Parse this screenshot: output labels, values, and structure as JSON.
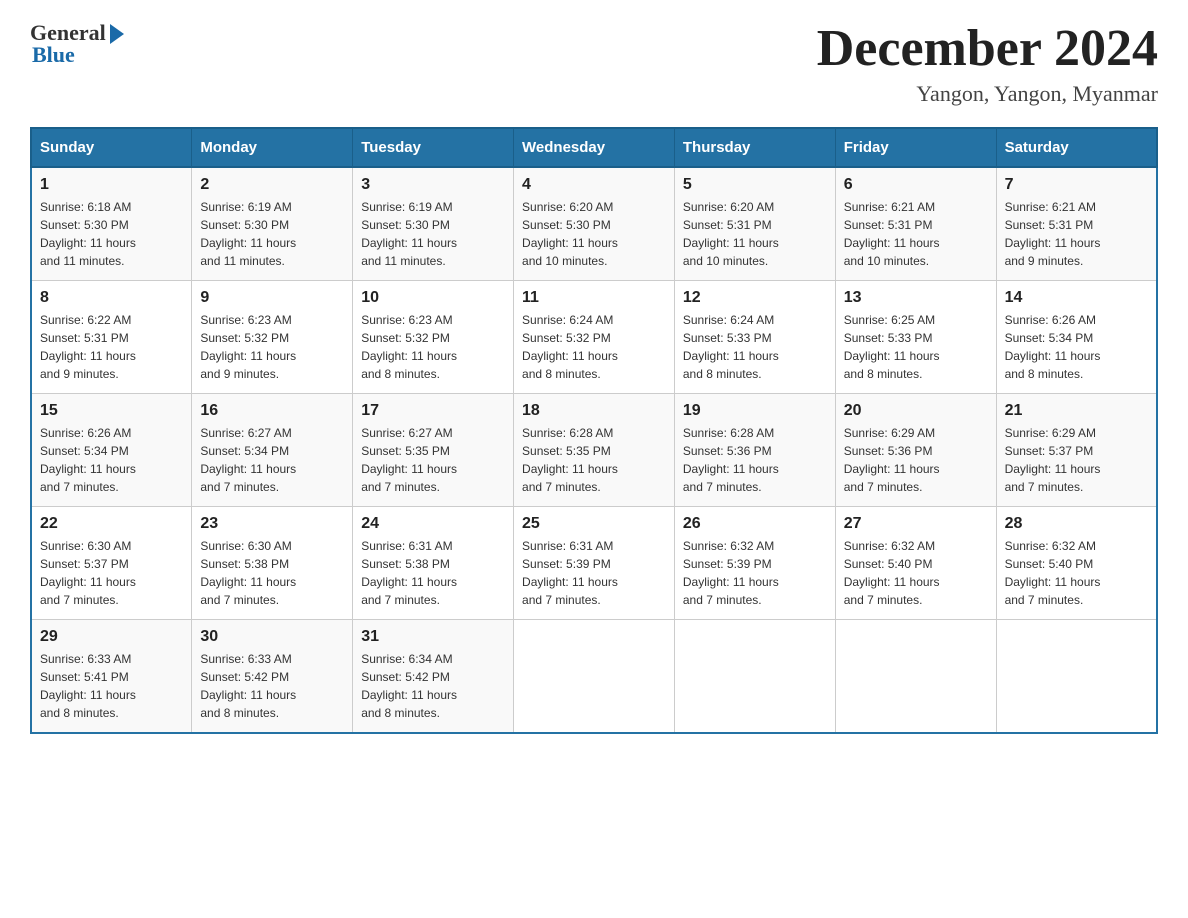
{
  "header": {
    "logo_general": "General",
    "logo_blue": "Blue",
    "month_title": "December 2024",
    "location": "Yangon, Yangon, Myanmar"
  },
  "days_of_week": [
    "Sunday",
    "Monday",
    "Tuesday",
    "Wednesday",
    "Thursday",
    "Friday",
    "Saturday"
  ],
  "weeks": [
    [
      {
        "num": "1",
        "sunrise": "6:18 AM",
        "sunset": "5:30 PM",
        "daylight": "11 hours and 11 minutes."
      },
      {
        "num": "2",
        "sunrise": "6:19 AM",
        "sunset": "5:30 PM",
        "daylight": "11 hours and 11 minutes."
      },
      {
        "num": "3",
        "sunrise": "6:19 AM",
        "sunset": "5:30 PM",
        "daylight": "11 hours and 11 minutes."
      },
      {
        "num": "4",
        "sunrise": "6:20 AM",
        "sunset": "5:30 PM",
        "daylight": "11 hours and 10 minutes."
      },
      {
        "num": "5",
        "sunrise": "6:20 AM",
        "sunset": "5:31 PM",
        "daylight": "11 hours and 10 minutes."
      },
      {
        "num": "6",
        "sunrise": "6:21 AM",
        "sunset": "5:31 PM",
        "daylight": "11 hours and 10 minutes."
      },
      {
        "num": "7",
        "sunrise": "6:21 AM",
        "sunset": "5:31 PM",
        "daylight": "11 hours and 9 minutes."
      }
    ],
    [
      {
        "num": "8",
        "sunrise": "6:22 AM",
        "sunset": "5:31 PM",
        "daylight": "11 hours and 9 minutes."
      },
      {
        "num": "9",
        "sunrise": "6:23 AM",
        "sunset": "5:32 PM",
        "daylight": "11 hours and 9 minutes."
      },
      {
        "num": "10",
        "sunrise": "6:23 AM",
        "sunset": "5:32 PM",
        "daylight": "11 hours and 8 minutes."
      },
      {
        "num": "11",
        "sunrise": "6:24 AM",
        "sunset": "5:32 PM",
        "daylight": "11 hours and 8 minutes."
      },
      {
        "num": "12",
        "sunrise": "6:24 AM",
        "sunset": "5:33 PM",
        "daylight": "11 hours and 8 minutes."
      },
      {
        "num": "13",
        "sunrise": "6:25 AM",
        "sunset": "5:33 PM",
        "daylight": "11 hours and 8 minutes."
      },
      {
        "num": "14",
        "sunrise": "6:26 AM",
        "sunset": "5:34 PM",
        "daylight": "11 hours and 8 minutes."
      }
    ],
    [
      {
        "num": "15",
        "sunrise": "6:26 AM",
        "sunset": "5:34 PM",
        "daylight": "11 hours and 7 minutes."
      },
      {
        "num": "16",
        "sunrise": "6:27 AM",
        "sunset": "5:34 PM",
        "daylight": "11 hours and 7 minutes."
      },
      {
        "num": "17",
        "sunrise": "6:27 AM",
        "sunset": "5:35 PM",
        "daylight": "11 hours and 7 minutes."
      },
      {
        "num": "18",
        "sunrise": "6:28 AM",
        "sunset": "5:35 PM",
        "daylight": "11 hours and 7 minutes."
      },
      {
        "num": "19",
        "sunrise": "6:28 AM",
        "sunset": "5:36 PM",
        "daylight": "11 hours and 7 minutes."
      },
      {
        "num": "20",
        "sunrise": "6:29 AM",
        "sunset": "5:36 PM",
        "daylight": "11 hours and 7 minutes."
      },
      {
        "num": "21",
        "sunrise": "6:29 AM",
        "sunset": "5:37 PM",
        "daylight": "11 hours and 7 minutes."
      }
    ],
    [
      {
        "num": "22",
        "sunrise": "6:30 AM",
        "sunset": "5:37 PM",
        "daylight": "11 hours and 7 minutes."
      },
      {
        "num": "23",
        "sunrise": "6:30 AM",
        "sunset": "5:38 PM",
        "daylight": "11 hours and 7 minutes."
      },
      {
        "num": "24",
        "sunrise": "6:31 AM",
        "sunset": "5:38 PM",
        "daylight": "11 hours and 7 minutes."
      },
      {
        "num": "25",
        "sunrise": "6:31 AM",
        "sunset": "5:39 PM",
        "daylight": "11 hours and 7 minutes."
      },
      {
        "num": "26",
        "sunrise": "6:32 AM",
        "sunset": "5:39 PM",
        "daylight": "11 hours and 7 minutes."
      },
      {
        "num": "27",
        "sunrise": "6:32 AM",
        "sunset": "5:40 PM",
        "daylight": "11 hours and 7 minutes."
      },
      {
        "num": "28",
        "sunrise": "6:32 AM",
        "sunset": "5:40 PM",
        "daylight": "11 hours and 7 minutes."
      }
    ],
    [
      {
        "num": "29",
        "sunrise": "6:33 AM",
        "sunset": "5:41 PM",
        "daylight": "11 hours and 8 minutes."
      },
      {
        "num": "30",
        "sunrise": "6:33 AM",
        "sunset": "5:42 PM",
        "daylight": "11 hours and 8 minutes."
      },
      {
        "num": "31",
        "sunrise": "6:34 AM",
        "sunset": "5:42 PM",
        "daylight": "11 hours and 8 minutes."
      },
      null,
      null,
      null,
      null
    ]
  ],
  "labels": {
    "sunrise": "Sunrise:",
    "sunset": "Sunset:",
    "daylight": "Daylight:"
  }
}
